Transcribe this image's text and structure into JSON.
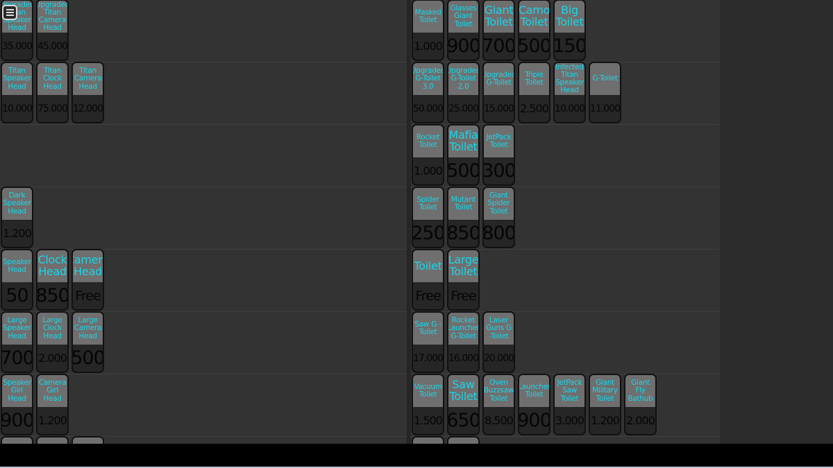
{
  "colors": {
    "name_text": "#19d6e8",
    "card_top": "#6f6f6f",
    "card_bottom": "#262626",
    "background": "#333333"
  },
  "menu_icon": "hamburger-menu-icon",
  "left_rows": [
    [
      {
        "name": "Upgraded Titan Speaker Head",
        "price": "35.000"
      },
      {
        "name": "Upgraded Titan Camera Head",
        "price": "45.000"
      }
    ],
    [
      {
        "name": "Titan Speaker Head",
        "price": "10.000"
      },
      {
        "name": "Titan Clock Head",
        "price": "75.000"
      },
      {
        "name": "Titan Camera Head",
        "price": "12.000"
      }
    ],
    [],
    [
      {
        "name": "Dark Speaker Head",
        "price": "1.200"
      }
    ],
    [
      {
        "name": "Speaker Head",
        "price": "50"
      },
      {
        "name": "Clock Head",
        "price": "850"
      },
      {
        "name": "Camera Head",
        "price": "Free"
      }
    ],
    [
      {
        "name": "Large Speaker Head",
        "price": "700"
      },
      {
        "name": "Large Clock Head",
        "price": "2.000"
      },
      {
        "name": "Large Camera Head",
        "price": "500"
      }
    ],
    [
      {
        "name": "Speaker Girl Head",
        "price": "900"
      },
      {
        "name": "Camera Girl Head",
        "price": "1.200"
      }
    ],
    [
      {
        "name": "",
        "price": ""
      },
      {
        "name": "",
        "price": ""
      },
      {
        "name": "",
        "price": ""
      }
    ]
  ],
  "right_rows": [
    [
      {
        "name": "Masked Toilet",
        "price": "1.000"
      },
      {
        "name": "Glasses Giant Toilet",
        "price": "900"
      },
      {
        "name": "Giant Toilet",
        "price": "700"
      },
      {
        "name": "Camo Toilet",
        "price": "500"
      },
      {
        "name": "Big Toilet",
        "price": "150"
      }
    ],
    [
      {
        "name": "Upgraded G-Toilet 3.0",
        "price": "50.000"
      },
      {
        "name": "Upgraded G-Toilet 2.0",
        "price": "25.000"
      },
      {
        "name": "Upgraded G-Toilet",
        "price": "15.000"
      },
      {
        "name": "Triple Toilet",
        "price": "2.500"
      },
      {
        "name": "Infected Titan Speaker Head",
        "price": "10.000"
      },
      {
        "name": "G-Toilet",
        "price": "11.000"
      }
    ],
    [
      {
        "name": "Rocket Toilet",
        "price": "1.000"
      },
      {
        "name": "Mafia Toilet",
        "price": "500"
      },
      {
        "name": "JetPack Toilet",
        "price": "300"
      }
    ],
    [
      {
        "name": "Spider Toilet",
        "price": "250"
      },
      {
        "name": "Mutant Toilet",
        "price": "850"
      },
      {
        "name": "Giant Spider Toilet",
        "price": "800"
      }
    ],
    [
      {
        "name": "Toilet",
        "price": "Free"
      },
      {
        "name": "Large Toilet",
        "price": "Free"
      }
    ],
    [
      {
        "name": "Saw G -Toilet",
        "price": "17.000"
      },
      {
        "name": "Rocket Launcher G-Toilet",
        "price": "16.000"
      },
      {
        "name": "Laser Guns G -Toilet",
        "price": "20.000"
      }
    ],
    [
      {
        "name": "Vacuum Toilet",
        "price": "1.500"
      },
      {
        "name": "Saw Toilet",
        "price": "650"
      },
      {
        "name": "Oven Buzzsaw Toilet",
        "price": "8.500"
      },
      {
        "name": "Launcher Toilet",
        "price": "900"
      },
      {
        "name": "JetPack Saw Toilet",
        "price": "3.000"
      },
      {
        "name": "Giant Military Toilet",
        "price": "1.200"
      },
      {
        "name": "Giant Fly Bathub",
        "price": "2.000"
      }
    ],
    [
      {
        "name": "",
        "price": ""
      },
      {
        "name": "",
        "price": ""
      }
    ]
  ]
}
